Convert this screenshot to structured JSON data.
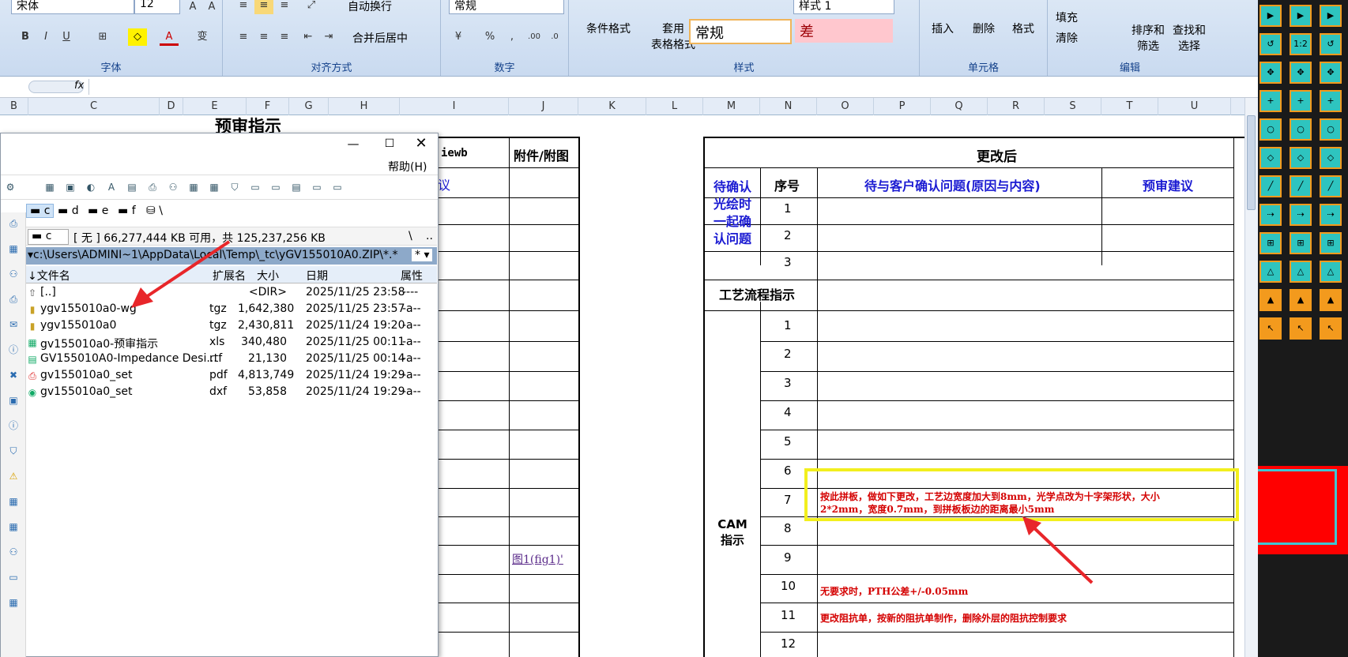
{
  "ribbon": {
    "font_name": "宋体",
    "font_size": "12",
    "wrap_text": "自动换行",
    "merge_center": "合并后居中",
    "number_format": "常规",
    "cond_format": "条件格式",
    "table_format_line1": "套用",
    "table_format_line2": "表格格式",
    "style1": "样式 1",
    "style_normal": "常规",
    "style_bad": "差",
    "insert": "插入",
    "delete": "删除",
    "format": "格式",
    "fill": "填充",
    "clear": "清除",
    "sort_filter_line1": "排序和",
    "sort_filter_line2": "筛选",
    "find_select_line1": "查找和",
    "find_select_line2": "选择",
    "groups": [
      "字体",
      "对齐方式",
      "数字",
      "样式",
      "单元格",
      "编辑"
    ]
  },
  "columns": [
    "B",
    "C",
    "D",
    "E",
    "F",
    "G",
    "H",
    "I",
    "J",
    "K",
    "L",
    "M",
    "N",
    "O",
    "P",
    "Q",
    "R",
    "S",
    "T",
    "U"
  ],
  "sheet": {
    "title": "预审指示",
    "col_i_header_partial": "iewb",
    "col_j_header": "附件/附图",
    "col_i_row1_partial": "议",
    "fig_link": "图1(fig1)'",
    "after_header": "更改后",
    "seq_header": "序号",
    "issues_header": "待与客户确认问题(原因与内容)",
    "advice_header": "预审建议",
    "pending_label": [
      "待确认",
      "光绘时",
      "一起确",
      "认问题"
    ],
    "pending_rows": [
      "1",
      "2",
      "3"
    ],
    "process_label": "工艺流程指示",
    "cam_label": [
      "CAM",
      "指示"
    ],
    "cam_rows": [
      "1",
      "2",
      "3",
      "4",
      "5",
      "6",
      "7",
      "8",
      "9",
      "10",
      "11",
      "12"
    ],
    "row7_line1": "按此拼板，做如下更改，工艺边宽度加大到8mm，光学点改为十字架形状，大小",
    "row7_line2": "2*2mm，宽度0.7mm，到拼板板边的距离最小5mm",
    "row10_text": "无要求时，PTH公差+/-0.05mm",
    "row11_text": "更改阻抗单，按新的阻抗单制作，删除外层的阻抗控制要求"
  },
  "file_manager": {
    "help_menu": "帮助(H)",
    "drives": [
      "c",
      "d",
      "e",
      "f",
      "\\"
    ],
    "drive_select": "c",
    "free_space": "[ 无 ]  66,277,444 KB 可用，共 125,237,256 KB",
    "root_btn": "\\",
    "up_btn": "..",
    "path": "c:\\Users\\ADMINI~1\\AppData\\Local\\Temp\\_tc\\yGV155010A0.ZIP\\*.*",
    "filter": "*",
    "headers": [
      "文件名",
      "扩展名",
      "大小",
      "日期",
      "属性"
    ],
    "files": [
      {
        "name": "[..]",
        "ext": "",
        "size": "<DIR>",
        "date": "2025/11/25 23:58",
        "attr": "----"
      },
      {
        "name": "ygv155010a0-wg",
        "ext": "tgz",
        "size": "1,642,380",
        "date": "2025/11/25 23:57",
        "attr": "-a--"
      },
      {
        "name": "ygv155010a0",
        "ext": "tgz",
        "size": "2,430,811",
        "date": "2025/11/24 19:20",
        "attr": "-a--"
      },
      {
        "name": "gv155010a0-预审指示",
        "ext": "xls",
        "size": "340,480",
        "date": "2025/11/25 00:11",
        "attr": "-a--"
      },
      {
        "name": "GV155010A0-Impedance Desi...",
        "ext": "rtf",
        "size": "21,130",
        "date": "2025/11/25 00:14",
        "attr": "-a--"
      },
      {
        "name": "gv155010a0_set",
        "ext": "pdf",
        "size": "4,813,749",
        "date": "2025/11/24 19:29",
        "attr": "-a--"
      },
      {
        "name": "gv155010a0_set",
        "ext": "dxf",
        "size": "53,858",
        "date": "2025/11/24 19:29",
        "attr": "-a--"
      }
    ]
  },
  "right_tools": [
    "1:2"
  ]
}
